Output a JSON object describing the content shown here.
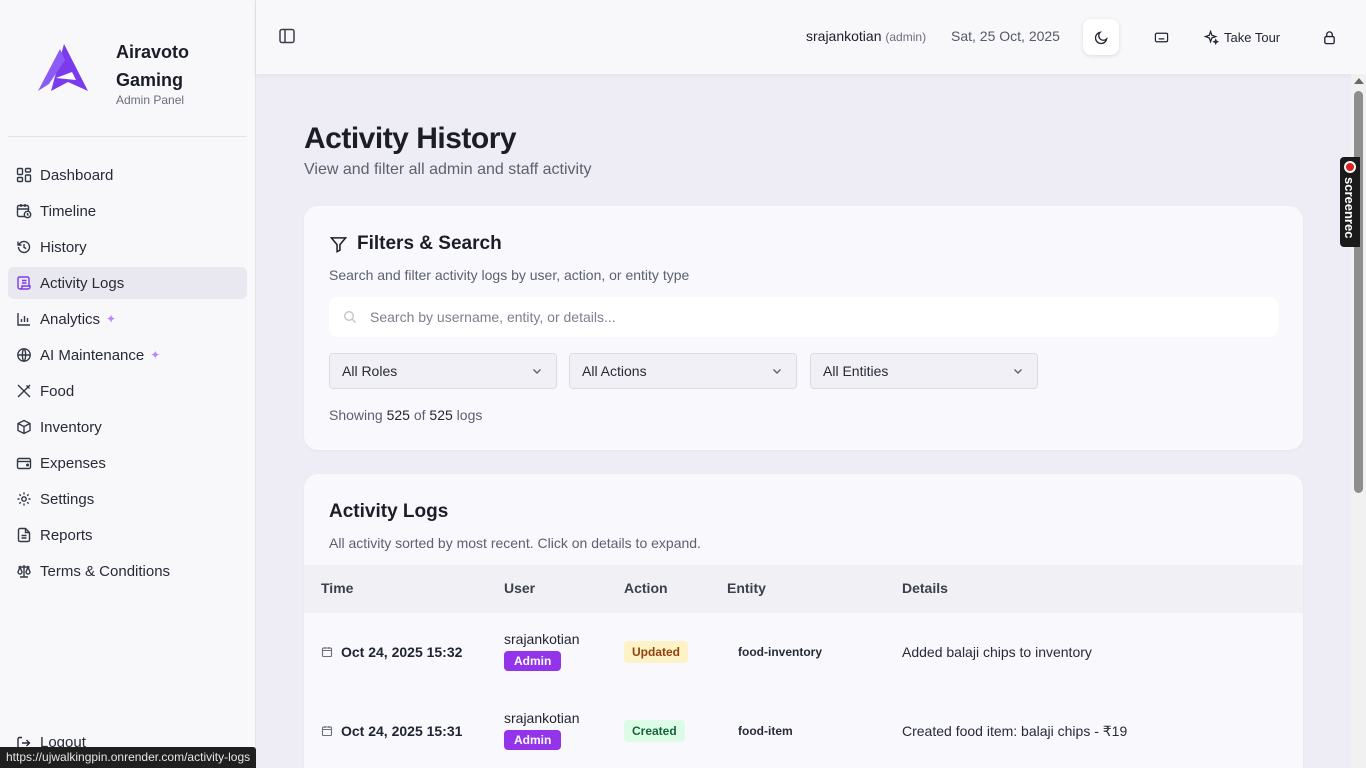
{
  "brand": {
    "name": "Airavoto Gaming",
    "subtitle": "Admin Panel",
    "logo_color": "#7c3aed"
  },
  "sidebar": {
    "items": [
      {
        "label": "Dashboard",
        "icon": "dashboard-icon"
      },
      {
        "label": "Timeline",
        "icon": "calendar-clock-icon"
      },
      {
        "label": "History",
        "icon": "history-icon"
      },
      {
        "label": "Activity Logs",
        "icon": "scroll-icon",
        "active": true
      },
      {
        "label": "Analytics",
        "icon": "bar-chart-icon",
        "sparkle": true
      },
      {
        "label": "AI Maintenance",
        "icon": "globe-icon",
        "sparkle": true
      },
      {
        "label": "Food",
        "icon": "utensils-icon"
      },
      {
        "label": "Inventory",
        "icon": "package-icon"
      },
      {
        "label": "Expenses",
        "icon": "wallet-icon"
      },
      {
        "label": "Settings",
        "icon": "gear-icon"
      },
      {
        "label": "Reports",
        "icon": "file-text-icon"
      },
      {
        "label": "Terms & Conditions",
        "icon": "scale-icon"
      }
    ],
    "logout_label": "Logout"
  },
  "topbar": {
    "username": "srajankotian",
    "role": "(admin)",
    "date": "Sat, 25 Oct, 2025",
    "tour_label": "Take Tour"
  },
  "page": {
    "title": "Activity History",
    "subtitle": "View and filter all admin and staff activity"
  },
  "filters": {
    "title": "Filters & Search",
    "subtitle": "Search and filter activity logs by user, action, or entity type",
    "search_placeholder": "Search by username, entity, or details...",
    "search_value": "",
    "role_select": "All Roles",
    "action_select": "All Actions",
    "entity_select": "All Entities",
    "count_prefix": "Showing",
    "count_shown": "525",
    "count_of": "of",
    "count_total": "525",
    "count_suffix": "logs"
  },
  "logs": {
    "title": "Activity Logs",
    "subtitle": "All activity sorted by most recent. Click on details to expand.",
    "columns": [
      "Time",
      "User",
      "Action",
      "Entity",
      "Details"
    ],
    "rows": [
      {
        "time": "Oct 24, 2025 15:32",
        "user": "srajankotian",
        "role": "Admin",
        "action": "Updated",
        "action_bg": "#fef3c7",
        "action_fg": "#92400e",
        "entity": "food-inventory",
        "details": "Added balaji chips to inventory"
      },
      {
        "time": "Oct 24, 2025 15:31",
        "user": "srajankotian",
        "role": "Admin",
        "action": "Created",
        "action_bg": "#dcfce7",
        "action_fg": "#166534",
        "entity": "food-item",
        "details": "Created food item: balaji chips - ₹19"
      }
    ]
  },
  "status_url": "https://ujwalkingpin.onrender.com/activity-logs",
  "screenrec_label": "screenrec"
}
